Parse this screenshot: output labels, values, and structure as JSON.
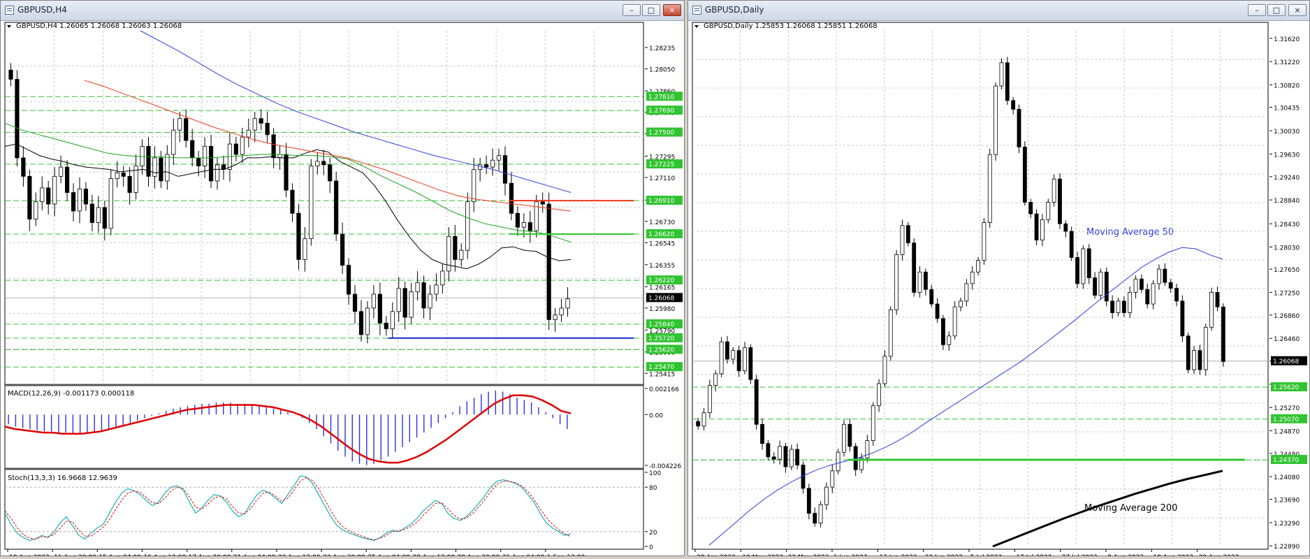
{
  "left_window": {
    "title": "GBPUSD,H4",
    "header": "GBPUSD,H4  1.26065 1.26068 1.26063 1.26068",
    "macd_label": "MACD(12,26,9) -0.001173 0.000118",
    "stoch_label": "Stoch(13,3,3) 16.9668 12.9639",
    "minimize_glyph": "–",
    "maximize_glyph": "□",
    "close_glyph": "×"
  },
  "right_window": {
    "title": "GBPUSD,Daily",
    "header": "GBPUSD,Daily  1.25853 1.26068 1.25851 1.26068",
    "ma50_label": "Moving Average 50",
    "ma200_label": "Moving Average 200",
    "minimize_glyph": "–",
    "maximize_glyph": "□",
    "close_glyph": "×"
  },
  "colors": {
    "bull": "#ffffff",
    "bear": "#000000",
    "grid": "#c8c8c8",
    "ma_blue": "#2b3fe0",
    "ma_red": "#f03a18",
    "ma_green": "#17a317",
    "ma_black": "#000000",
    "level_green": "#31c431",
    "level_red": "#f03a18",
    "level_blue": "#1a2ccc",
    "macd_hist": "#3030dd",
    "macd_signal": "#e00000",
    "stoch_main": "#1ab0b8",
    "stoch_signal": "#e00000"
  },
  "chart_data": [
    {
      "id": "h4",
      "type": "candlestick",
      "title": "GBPUSD,H4",
      "ylim": [
        1.2532,
        1.2838
      ],
      "y_ticks": [
        "1.28235",
        "1.28050",
        "1.27860",
        "1.27675",
        "1.27490",
        "1.27295",
        "1.27110",
        "1.26915",
        "1.26730",
        "1.26545",
        "1.26355",
        "1.26165",
        "1.25980",
        "1.25790",
        "1.25600",
        "1.25415"
      ],
      "x_ticks": [
        "10 Aug 2023",
        "11 Aug 20:00",
        "15 Aug 04:00",
        "16 Aug 12:00",
        "17 Aug 20:00",
        "21 Aug 04:00",
        "22 Aug 12:00",
        "23 Aug 20:00",
        "25 Aug 04:00",
        "28 Aug 12:00",
        "29 Aug 20:00",
        "31 Aug 04:00",
        "1 Sep 12:00"
      ],
      "last_price": "1.26068",
      "level_labels": [
        "1.27810",
        "1.27690",
        "1.27500",
        "1.27225",
        "1.26910",
        "1.26620",
        "1.26220",
        "1.25840",
        "1.25720",
        "1.25620",
        "1.25470"
      ],
      "levels": [
        {
          "value": 1.2781,
          "style": "dash",
          "color": "green"
        },
        {
          "value": 1.2769,
          "style": "dash",
          "color": "green"
        },
        {
          "value": 1.275,
          "style": "dash",
          "color": "green"
        },
        {
          "value": 1.27225,
          "style": "dash",
          "color": "green"
        },
        {
          "value": 1.2691,
          "style": "dash",
          "color": "green"
        },
        {
          "value": 1.2662,
          "style": "dash",
          "color": "green"
        },
        {
          "value": 1.2622,
          "style": "dash",
          "color": "green"
        },
        {
          "value": 1.2584,
          "style": "dash",
          "color": "green"
        },
        {
          "value": 1.2572,
          "style": "dash",
          "color": "green"
        },
        {
          "value": 1.2562,
          "style": "dash",
          "color": "green"
        },
        {
          "value": 1.2547,
          "style": "dash",
          "color": "green"
        }
      ],
      "segments": [
        {
          "value": 1.2691,
          "from": 0.79,
          "to": 0.985,
          "color": "red"
        },
        {
          "value": 1.2662,
          "from": 0.79,
          "to": 0.985,
          "color": "green"
        },
        {
          "value": 1.2572,
          "from": 0.6,
          "to": 0.985,
          "color": "blue"
        }
      ],
      "closes": [
        1.2796,
        1.2728,
        1.2712,
        1.2675,
        1.269,
        1.2702,
        1.2688,
        1.2712,
        1.272,
        1.2698,
        1.2682,
        1.2701,
        1.2688,
        1.2672,
        1.2685,
        1.2667,
        1.271,
        1.2715,
        1.2712,
        1.2698,
        1.2721,
        1.2738,
        1.2712,
        1.2728,
        1.2708,
        1.2731,
        1.2752,
        1.2762,
        1.2743,
        1.2728,
        1.2721,
        1.2738,
        1.2708,
        1.2722,
        1.2718,
        1.274,
        1.2731,
        1.2746,
        1.2752,
        1.2762,
        1.2758,
        1.2748,
        1.2728,
        1.2731,
        1.27,
        1.268,
        1.264,
        1.2658,
        1.2721,
        1.2725,
        1.2722,
        1.2708,
        1.2662,
        1.2635,
        1.261,
        1.2595,
        1.2575,
        1.2598,
        1.261,
        1.2585,
        1.258,
        1.2595,
        1.2615,
        1.259,
        1.2612,
        1.262,
        1.2598,
        1.261,
        1.2618,
        1.263,
        1.266,
        1.264,
        1.2648,
        1.269,
        1.2718,
        1.2722,
        1.272,
        1.2726,
        1.273,
        1.2706,
        1.268,
        1.2668,
        1.2672,
        1.2665,
        1.269,
        1.2688,
        1.2588,
        1.2592,
        1.2598,
        1.2606
      ],
      "ma_black": [
        1.2738,
        1.274,
        1.2735,
        1.273,
        1.2727,
        1.2725,
        1.2722,
        1.272,
        1.2719,
        1.2718,
        1.2716,
        1.2717,
        1.2718,
        1.2715,
        1.2716,
        1.2712,
        1.2714,
        1.2716,
        1.2718,
        1.2718,
        1.2722,
        1.2728,
        1.2728,
        1.2729,
        1.2728,
        1.2728,
        1.2732,
        1.2735,
        1.2733,
        1.2725,
        1.272,
        1.2715,
        1.2704,
        1.269,
        1.2674,
        1.266,
        1.2648,
        1.264,
        1.2636,
        1.2634,
        1.2632,
        1.2636,
        1.2642,
        1.265,
        1.2651,
        1.2648,
        1.2647,
        1.2642,
        1.2639,
        1.264
      ],
      "ma_green": [
        1.2758,
        1.2752,
        1.2748,
        1.2744,
        1.274,
        1.2736,
        1.2732,
        1.273,
        1.2729,
        1.2729,
        1.2728,
        1.2728,
        1.2728,
        1.2729,
        1.273,
        1.2731,
        1.2731,
        1.273,
        1.273,
        1.2729,
        1.2727,
        1.272,
        1.2712,
        1.2705,
        1.2698,
        1.269,
        1.2682,
        1.2676,
        1.2671,
        1.2668,
        1.2665,
        1.2664,
        1.266,
        1.2655
      ],
      "ma_red": [
        1.2795,
        1.279,
        1.2784,
        1.2778,
        1.2772,
        1.2766,
        1.276,
        1.2754,
        1.2749,
        1.2744,
        1.274,
        1.2737,
        1.2734,
        1.2731,
        1.2728,
        1.2723,
        1.2718,
        1.2712,
        1.2706,
        1.27,
        1.2695,
        1.2692,
        1.269,
        1.2688,
        1.2686,
        1.2684,
        1.2682
      ],
      "ma_blue": [
        1.2838,
        1.2829,
        1.282,
        1.281,
        1.28,
        1.2791,
        1.2783,
        1.2775,
        1.2768,
        1.2762,
        1.2756,
        1.275,
        1.2745,
        1.274,
        1.2735,
        1.273,
        1.2726,
        1.2722,
        1.2718,
        1.2713,
        1.2708,
        1.2703,
        1.2698
      ]
    },
    {
      "id": "macd",
      "type": "histogram+line",
      "ylim": [
        -0.004226,
        0.002166
      ],
      "y_ticks": [
        "0.002166",
        "0.00",
        "-0.004226"
      ],
      "histogram": [
        -0.0008,
        -0.001,
        -0.0011,
        -0.0012,
        -0.0013,
        -0.0014,
        -0.0014,
        -0.0015,
        -0.0015,
        -0.0016,
        -0.0016,
        -0.0016,
        -0.0015,
        -0.0014,
        -0.0013,
        -0.0011,
        -0.0009,
        -0.0007,
        -0.0005,
        -0.0003,
        -0.0001,
        0.0001,
        0.0003,
        0.0005,
        0.0006,
        0.0007,
        0.0008,
        0.0009,
        0.0009,
        0.001,
        0.001,
        0.001,
        0.0009,
        0.0009,
        0.0008,
        0.0007,
        0.0006,
        0.0005,
        0.0004,
        0.0002,
        0.0,
        -0.0003,
        -0.0007,
        -0.0012,
        -0.0018,
        -0.0024,
        -0.003,
        -0.0035,
        -0.0039,
        -0.0041,
        -0.0042,
        -0.0041,
        -0.0038,
        -0.0035,
        -0.0031,
        -0.0027,
        -0.0023,
        -0.0019,
        -0.0015,
        -0.0011,
        -0.0007,
        -0.0003,
        0.0002,
        0.0007,
        0.0011,
        0.0014,
        0.0017,
        0.0019,
        0.002,
        0.0019,
        0.0017,
        0.0014,
        0.0012,
        0.001,
        0.0006,
        0.0002,
        -0.0003,
        -0.0008,
        -0.0012
      ],
      "signal": [
        -0.001,
        -0.0012,
        -0.0013,
        -0.0014,
        -0.0015,
        -0.0015,
        -0.0016,
        -0.0016,
        -0.0016,
        -0.0015,
        -0.0014,
        -0.0012,
        -0.001,
        -0.0008,
        -0.0006,
        -0.0004,
        -0.0002,
        0.0,
        0.0002,
        0.0004,
        0.0005,
        0.0006,
        0.0007,
        0.0008,
        0.0008,
        0.0008,
        0.0008,
        0.0007,
        0.0006,
        0.0004,
        0.0002,
        -0.0001,
        -0.0005,
        -0.001,
        -0.0016,
        -0.0022,
        -0.0028,
        -0.0033,
        -0.0037,
        -0.0039,
        -0.004,
        -0.004,
        -0.0038,
        -0.0035,
        -0.0031,
        -0.0026,
        -0.0021,
        -0.0015,
        -0.0009,
        -0.0003,
        0.0003,
        0.0009,
        0.0013,
        0.0016,
        0.0016,
        0.0015,
        0.0012,
        0.0008,
        0.0003,
        0.0001
      ]
    },
    {
      "id": "stoch",
      "type": "line",
      "ylim": [
        0,
        100
      ],
      "y_ticks": [
        "100",
        "80",
        "20",
        "0"
      ],
      "main": [
        45,
        30,
        18,
        12,
        8,
        10,
        15,
        12,
        20,
        32,
        40,
        28,
        15,
        10,
        18,
        25,
        30,
        45,
        60,
        72,
        78,
        75,
        70,
        62,
        55,
        60,
        72,
        80,
        82,
        76,
        60,
        45,
        52,
        62,
        70,
        68,
        60,
        48,
        40,
        45,
        58,
        70,
        76,
        72,
        65,
        58,
        70,
        82,
        95,
        94,
        85,
        70,
        55,
        40,
        28,
        22,
        18,
        15,
        12,
        10,
        8,
        12,
        18,
        22,
        20,
        25,
        30,
        38,
        48,
        55,
        62,
        58,
        45,
        38,
        35,
        40,
        48,
        58,
        68,
        80,
        88,
        90,
        88,
        85,
        80,
        70,
        60,
        45,
        32,
        25,
        20,
        15,
        17
      ],
      "signal": [
        48,
        38,
        25,
        16,
        11,
        10,
        13,
        13,
        16,
        25,
        34,
        33,
        22,
        14,
        14,
        20,
        26,
        36,
        50,
        63,
        72,
        75,
        73,
        66,
        59,
        58,
        65,
        75,
        80,
        78,
        67,
        53,
        50,
        57,
        65,
        68,
        64,
        54,
        45,
        44,
        52,
        63,
        72,
        73,
        68,
        61,
        65,
        76,
        88,
        93,
        89,
        78,
        63,
        48,
        35,
        26,
        21,
        17,
        14,
        11,
        9,
        11,
        15,
        20,
        21,
        23,
        27,
        33,
        42,
        50,
        58,
        59,
        51,
        42,
        37,
        38,
        44,
        53,
        63,
        74,
        84,
        88,
        88,
        86,
        82,
        74,
        64,
        51,
        39,
        30,
        23,
        17,
        13
      ]
    },
    {
      "id": "daily",
      "type": "candlestick",
      "title": "GBPUSD,Daily",
      "ylim": [
        1.2288,
        1.3175
      ],
      "y_ticks": [
        "1.31620",
        "1.31220",
        "1.30820",
        "1.30435",
        "1.30030",
        "1.29630",
        "1.29240",
        "1.28840",
        "1.28430",
        "1.28030",
        "1.27650",
        "1.27250",
        "1.26860",
        "1.26460",
        "1.26068",
        "1.25670",
        "1.25270",
        "1.24870",
        "1.24480",
        "1.24080",
        "1.23690",
        "1.23290",
        "1.22890"
      ],
      "x_ticks": [
        "28 Apr 2023",
        "10 May 2023",
        "22 May 2023",
        "1 Jun 2023",
        "13 Jun 2023",
        "23 Jun 2023",
        "5 Jul 2023",
        "17 Jul 2023",
        "27 Jul 2023",
        "8 Aug 2023",
        "18 Aug 2023",
        "30 Aug 2023"
      ],
      "last_price": "1.26068",
      "level_labels": [
        "1.25620",
        "1.25070",
        "1.24370"
      ],
      "levels": [
        {
          "value": 1.2562,
          "style": "dash",
          "color": "green"
        },
        {
          "value": 1.2507,
          "style": "dash",
          "color": "green"
        },
        {
          "value": 1.2437,
          "style": "dash",
          "color": "green"
        }
      ],
      "segments": [
        {
          "value": 1.2437,
          "from": 0.27,
          "to": 0.96,
          "color": "green"
        }
      ],
      "closes": [
        1.2495,
        1.2518,
        1.2565,
        1.2585,
        1.264,
        1.261,
        1.2625,
        1.259,
        1.263,
        1.2575,
        1.2498,
        1.2465,
        1.2442,
        1.2438,
        1.246,
        1.2425,
        1.2455,
        1.2428,
        1.2388,
        1.2345,
        1.2328,
        1.236,
        1.239,
        1.2418,
        1.245,
        1.2498,
        1.246,
        1.242,
        1.244,
        1.247,
        1.253,
        1.2568,
        1.2615,
        1.2695,
        1.279,
        1.284,
        1.281,
        1.2725,
        1.276,
        1.273,
        1.2705,
        1.268,
        1.2635,
        1.265,
        1.27,
        1.271,
        1.274,
        1.276,
        1.278,
        1.2845,
        1.2962,
        1.308,
        1.312,
        1.3055,
        1.304,
        1.2975,
        1.288,
        1.286,
        1.2815,
        1.285,
        1.288,
        1.292,
        1.2843,
        1.283,
        1.2785,
        1.274,
        1.28,
        1.275,
        1.272,
        1.276,
        1.271,
        1.269,
        1.271,
        1.269,
        1.2725,
        1.2748,
        1.273,
        1.2705,
        1.274,
        1.2765,
        1.2742,
        1.2732,
        1.271,
        1.265,
        1.2592,
        1.2625,
        1.2592,
        1.2665,
        1.2725,
        1.27,
        1.2606
      ],
      "ma50": [
        1.229,
        1.231,
        1.233,
        1.235,
        1.2368,
        1.2384,
        1.2398,
        1.241,
        1.242,
        1.2428,
        1.2434,
        1.244,
        1.2448,
        1.2458,
        1.247,
        1.2484,
        1.25,
        1.2515,
        1.253,
        1.2545,
        1.256,
        1.2575,
        1.259,
        1.2605,
        1.2622,
        1.264,
        1.2658,
        1.2676,
        1.2695,
        1.2714,
        1.2732,
        1.275,
        1.2768,
        1.2782,
        1.2794,
        1.2802,
        1.28,
        1.279,
        1.2782
      ],
      "ma200": [
        1.2288,
        1.23,
        1.2312,
        1.2324,
        1.2336,
        1.2347,
        1.2358,
        1.2368,
        1.2378,
        1.2387,
        1.2396,
        1.2404,
        1.2411,
        1.2418
      ]
    }
  ]
}
